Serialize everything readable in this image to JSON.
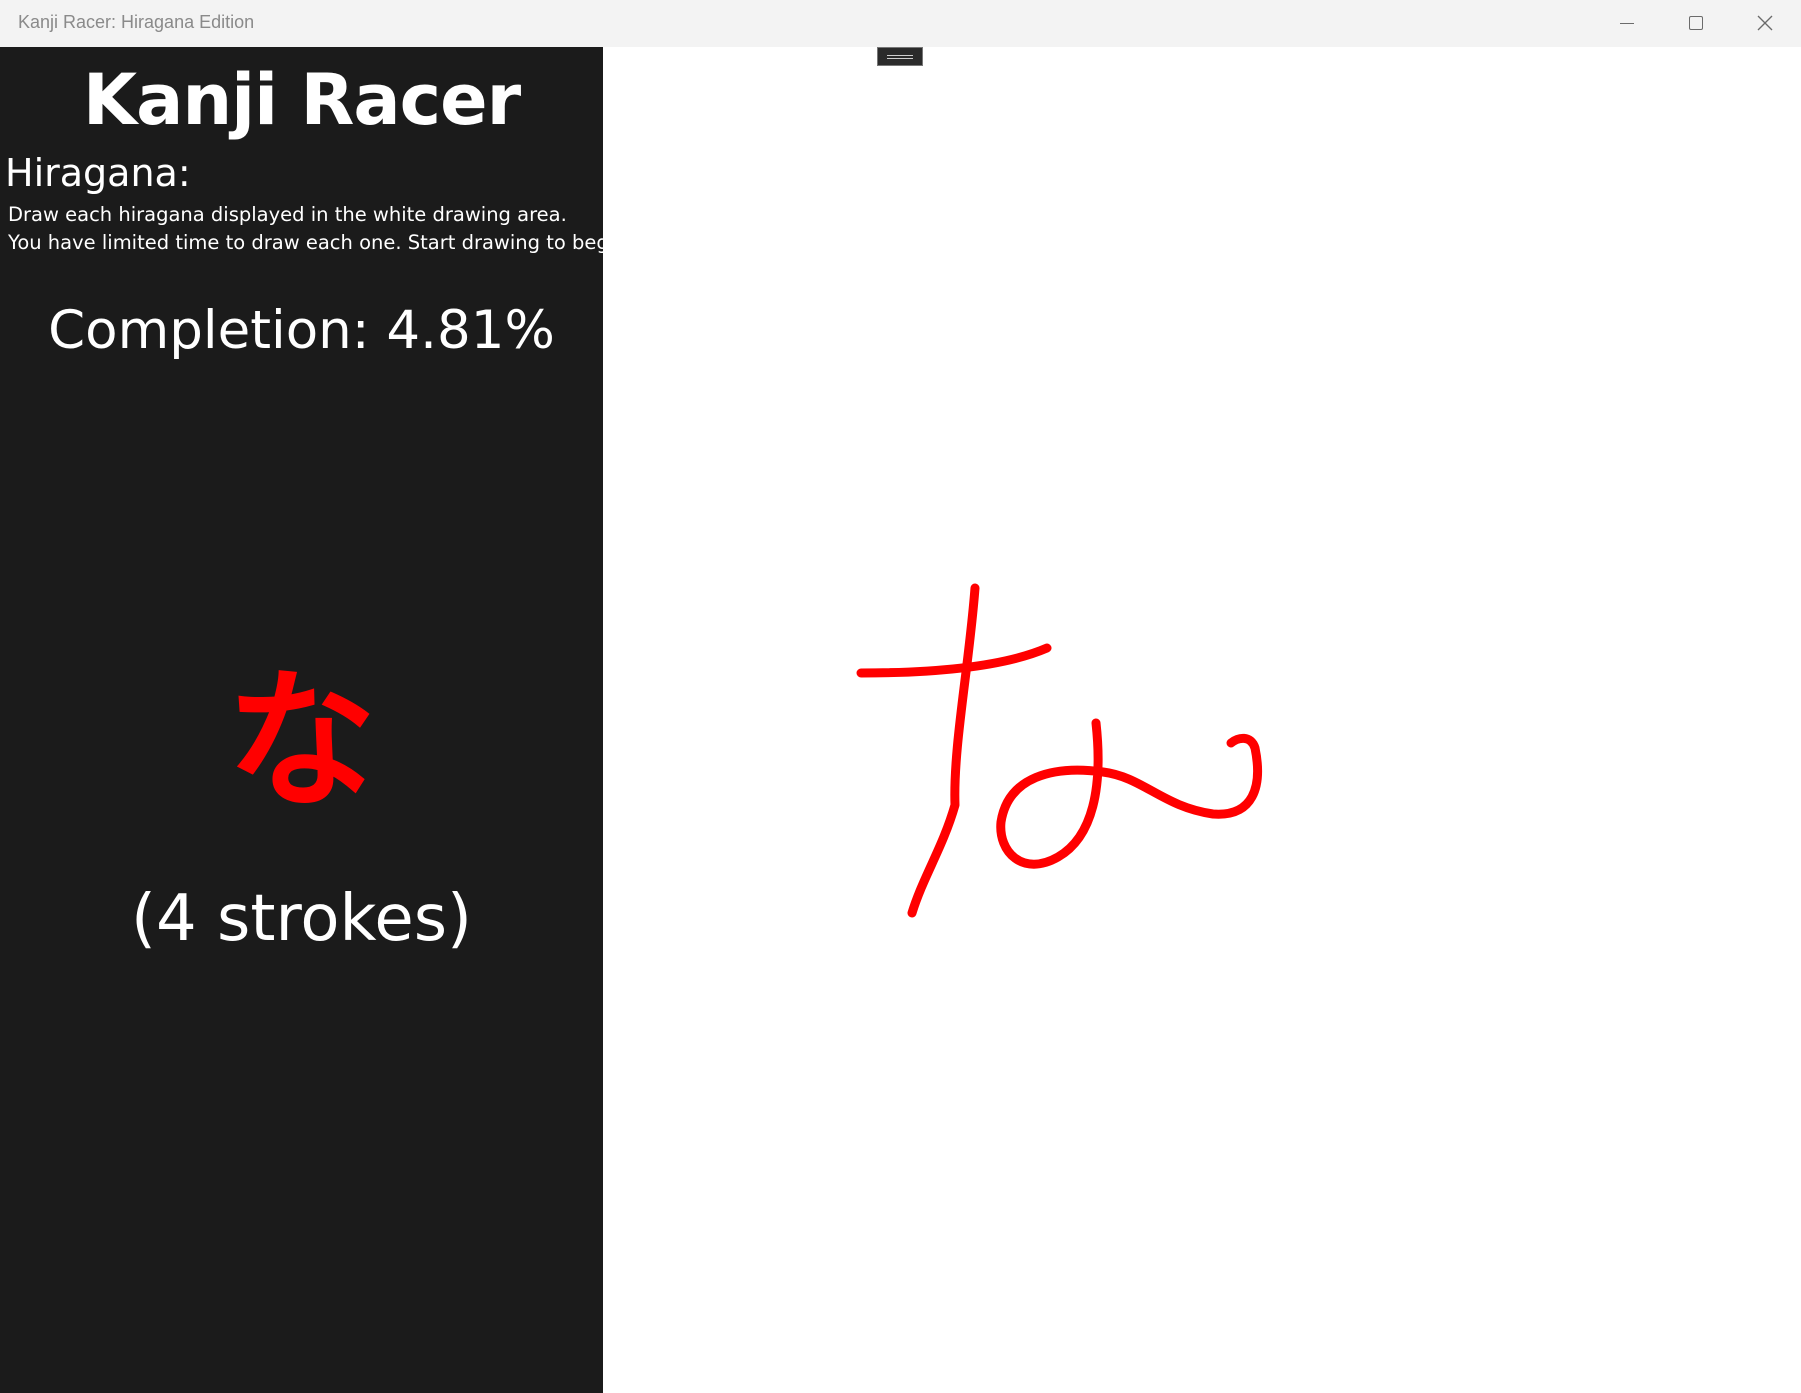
{
  "window": {
    "title": "Kanji Racer: Hiragana Edition",
    "controls": [
      "minimize",
      "maximize",
      "close"
    ]
  },
  "sidebar": {
    "app_title": "Kanji Racer",
    "section_heading": "Hiragana:",
    "instructions": [
      "Draw each hiragana displayed in the white drawing area.",
      "You have limited time to draw each one. Start drawing to begin."
    ],
    "completion": "Completion: 4.81%",
    "target_character": "な",
    "stroke_count": "(4 strokes)"
  },
  "drawing_area": {
    "ink_color": "#ff0000",
    "stroke_count_drawn": 4
  },
  "colors": {
    "sidebar_bg": "#1b1b1b",
    "titlebar_bg": "#f3f3f3",
    "accent": "#ff0000",
    "canvas_bg": "#ffffff"
  },
  "icons": {
    "minimize": "minimize-icon",
    "maximize": "maximize-icon",
    "close": "close-icon",
    "grip": "drag-handle-icon"
  }
}
